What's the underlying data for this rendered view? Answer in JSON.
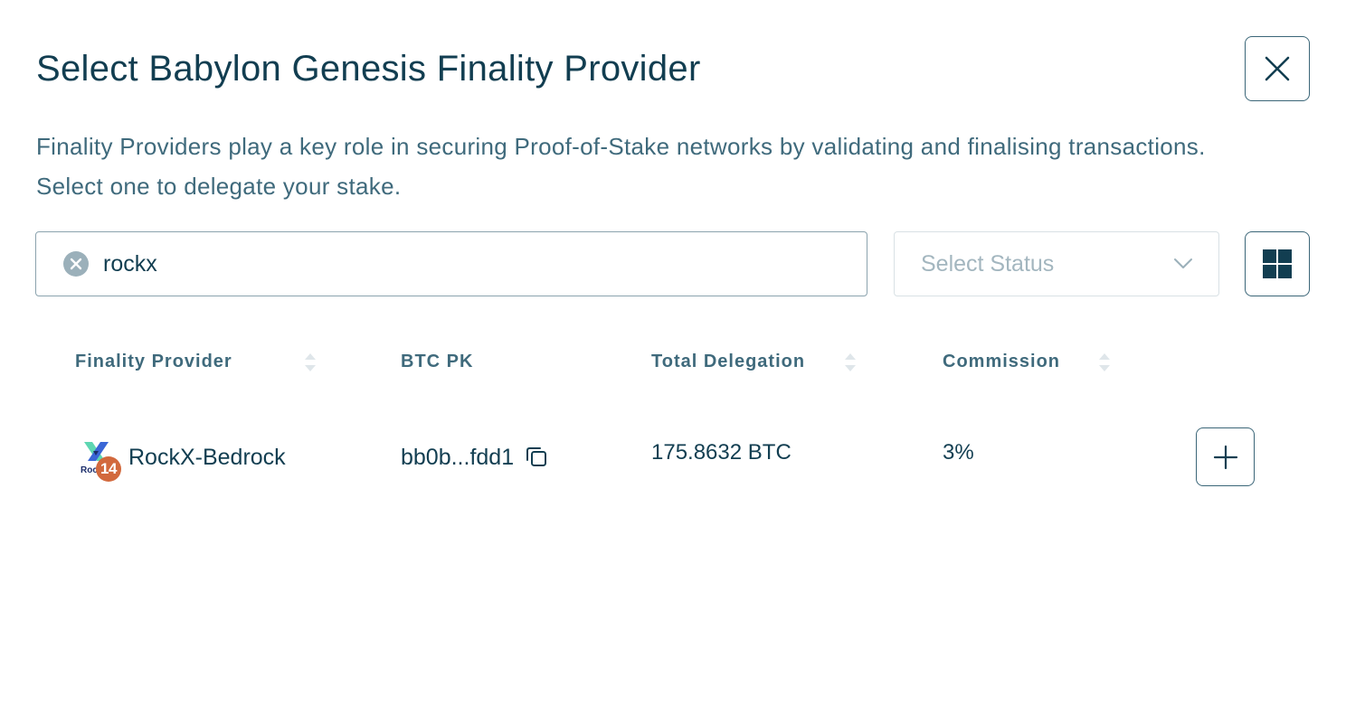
{
  "modal": {
    "title": "Select Babylon Genesis Finality Provider",
    "description": "Finality Providers play a key role in securing Proof-of-Stake networks by validating and finalising transactions. Select one to delegate your stake."
  },
  "search": {
    "value": "rockx"
  },
  "status_filter": {
    "placeholder": "Select Status"
  },
  "table": {
    "columns": [
      "Finality Provider",
      "BTC PK",
      "Total Delegation",
      "Commission"
    ],
    "rows": [
      {
        "name": "RockX-Bedrock",
        "rank": "14",
        "btc_pk": "bb0b...fdd1",
        "total_delegation": "175.8632 BTC",
        "commission": "3%"
      }
    ]
  },
  "icons": {
    "close": "close-icon",
    "clear": "clear-icon",
    "dropdown": "chevron-down-icon",
    "layout": "grid-icon",
    "sort": "sort-icon",
    "copy": "copy-icon",
    "add": "plus-icon",
    "logo": "rockx-logo"
  },
  "colors": {
    "primary": "#123e51",
    "muted": "#3f6a7c",
    "badge": "#d2693d"
  }
}
